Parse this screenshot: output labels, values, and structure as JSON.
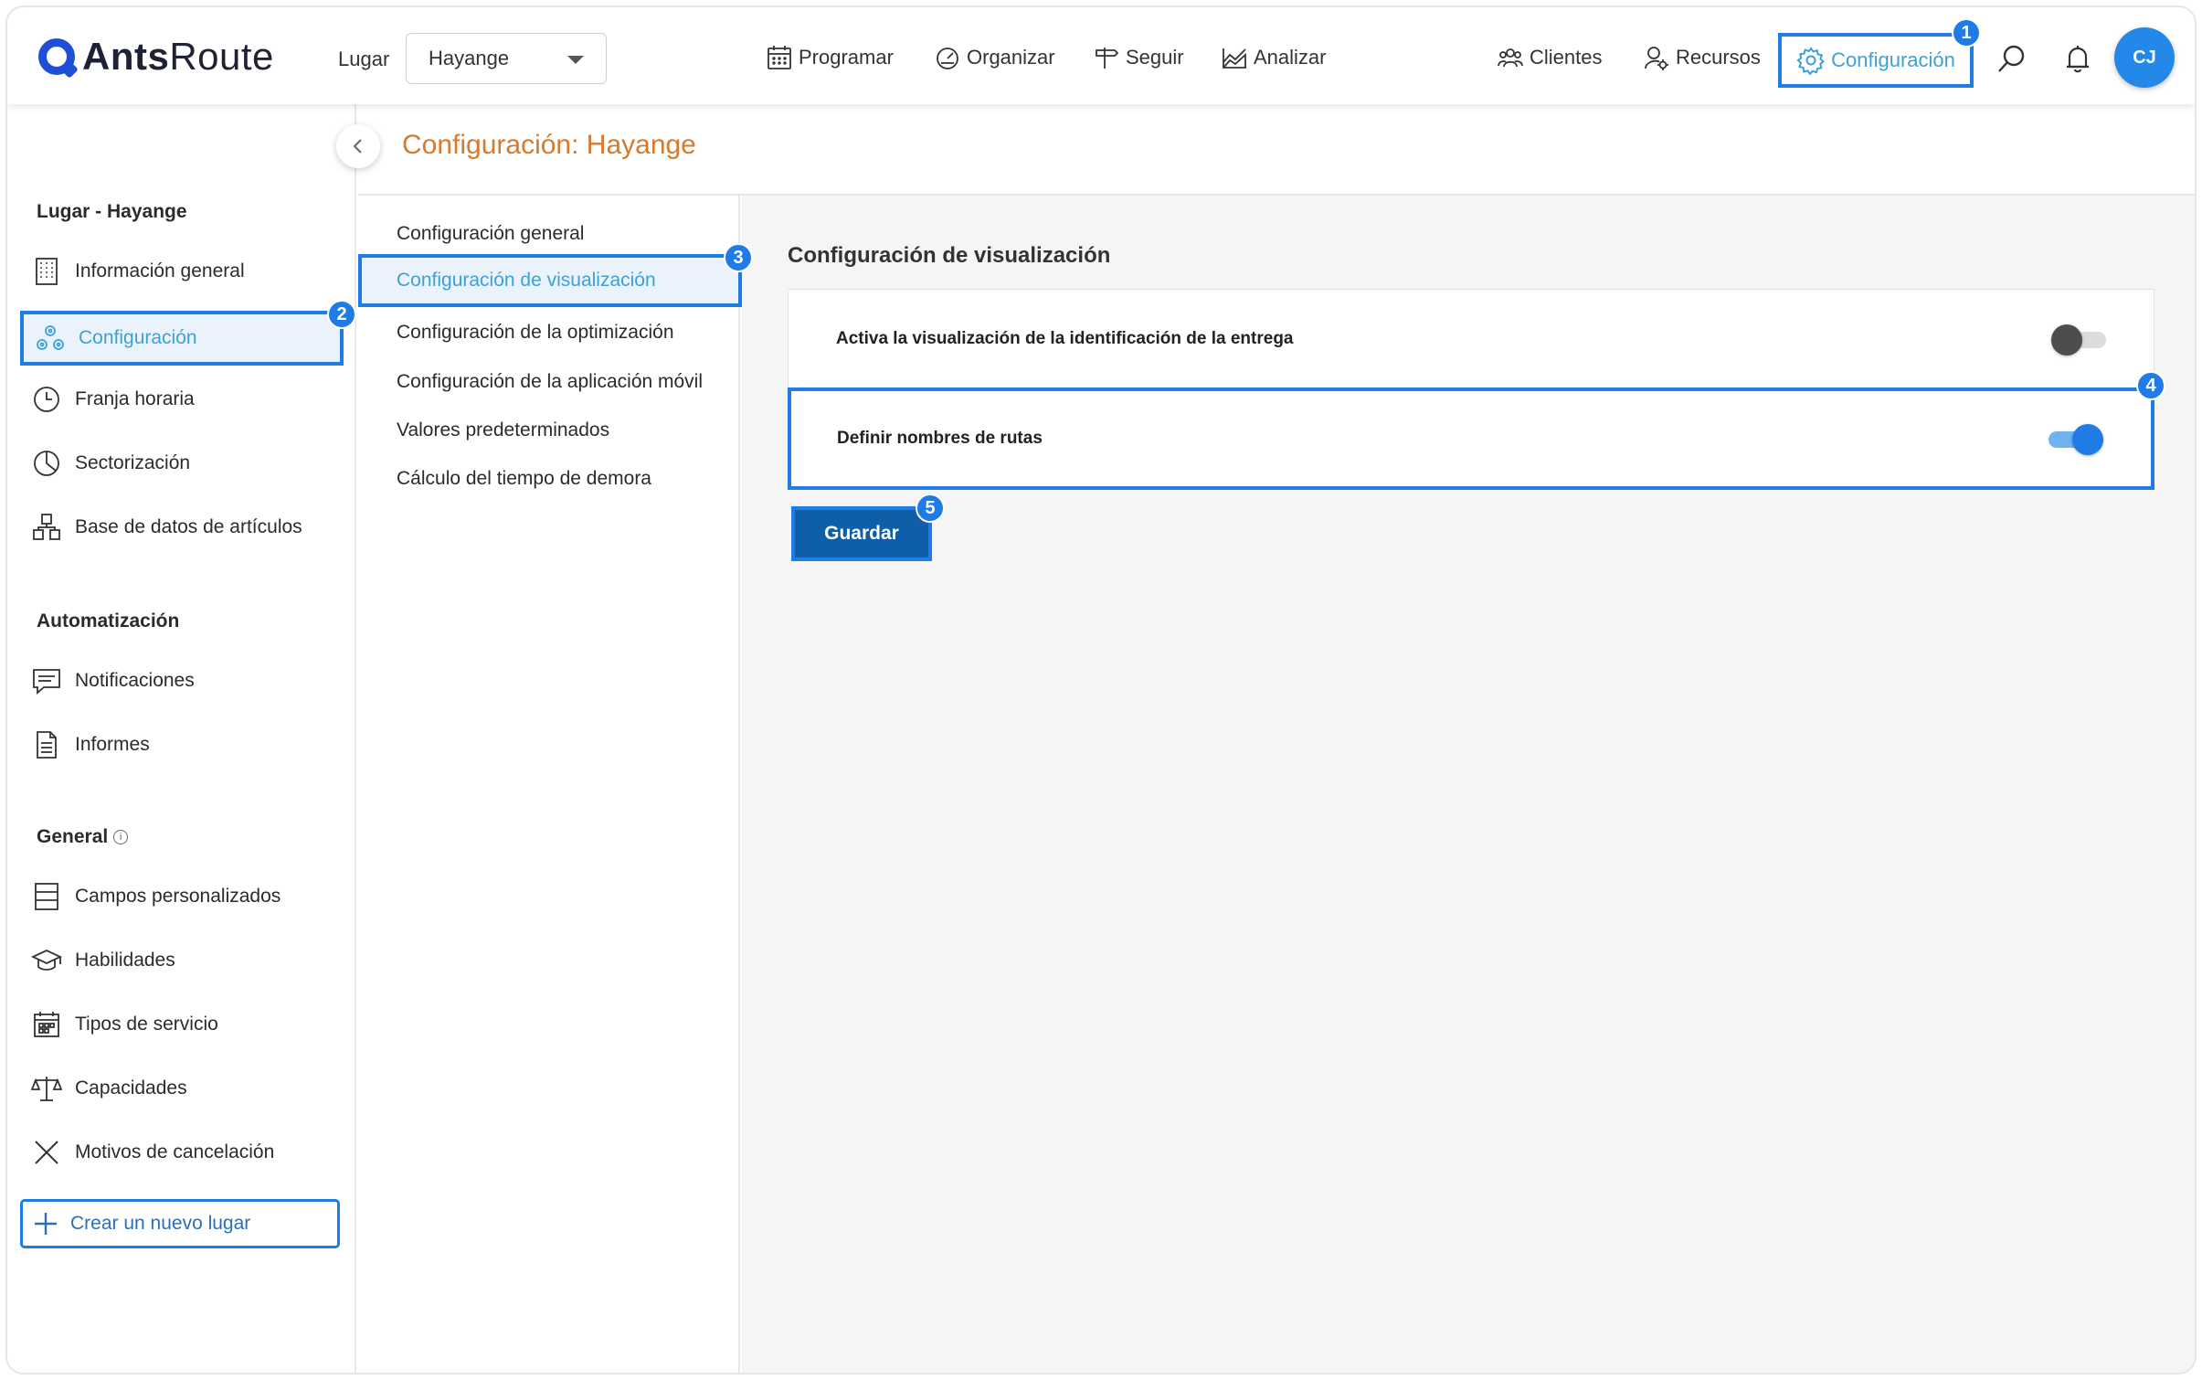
{
  "app": {
    "logo_text_bold": "Ants",
    "logo_text_light": "Route"
  },
  "topbar": {
    "place_label": "Lugar",
    "place_value": "Hayange",
    "nav": [
      {
        "label": "Programar",
        "icon": "calendar-icon"
      },
      {
        "label": "Organizar",
        "icon": "speedometer-icon"
      },
      {
        "label": "Seguir",
        "icon": "signpost-icon"
      },
      {
        "label": "Analizar",
        "icon": "chart-icon"
      }
    ],
    "right_nav": [
      {
        "label": "Clientes",
        "icon": "clients-icon"
      },
      {
        "label": "Recursos",
        "icon": "resources-icon"
      },
      {
        "label": "Configuración",
        "icon": "gear-icon",
        "active": true
      }
    ],
    "avatar_initials": "CJ"
  },
  "page": {
    "title": "Configuración: Hayange"
  },
  "sidebar": {
    "section_place": "Lugar - Hayange",
    "items_place": [
      {
        "label": "Información general",
        "icon": "building-icon"
      },
      {
        "label": "Configuración",
        "icon": "settings-network-icon",
        "active": true
      },
      {
        "label": "Franja horaria",
        "icon": "clock-icon"
      },
      {
        "label": "Sectorización",
        "icon": "pie-icon"
      },
      {
        "label": "Base de datos de artículos",
        "icon": "boxes-icon"
      }
    ],
    "section_automation": "Automatización",
    "items_automation": [
      {
        "label": "Notificaciones",
        "icon": "message-icon"
      },
      {
        "label": "Informes",
        "icon": "document-icon"
      }
    ],
    "section_general": "General",
    "items_general": [
      {
        "label": "Campos personalizados",
        "icon": "fields-icon"
      },
      {
        "label": "Habilidades",
        "icon": "graduation-icon"
      },
      {
        "label": "Tipos de servicio",
        "icon": "calendar-grid-icon"
      },
      {
        "label": "Capacidades",
        "icon": "scale-icon"
      },
      {
        "label": "Motivos de cancelación",
        "icon": "x-icon"
      }
    ],
    "new_place": "Crear un nuevo lugar"
  },
  "submenu": {
    "items": [
      "Configuración general",
      "Configuración de visualización",
      "Configuración de la optimización",
      "Configuración de la aplicación móvil",
      "Valores predeterminados",
      "Cálculo del tiempo de demora"
    ],
    "active_index": 1
  },
  "content": {
    "section_title": "Configuración de visualización",
    "options": [
      {
        "label": "Activa la visualización de la identificación de la entrega",
        "enabled": false
      },
      {
        "label": "Definir nombres de rutas",
        "enabled": true
      }
    ],
    "save_label": "Guardar"
  },
  "badges": [
    "1",
    "2",
    "3",
    "4",
    "5"
  ]
}
